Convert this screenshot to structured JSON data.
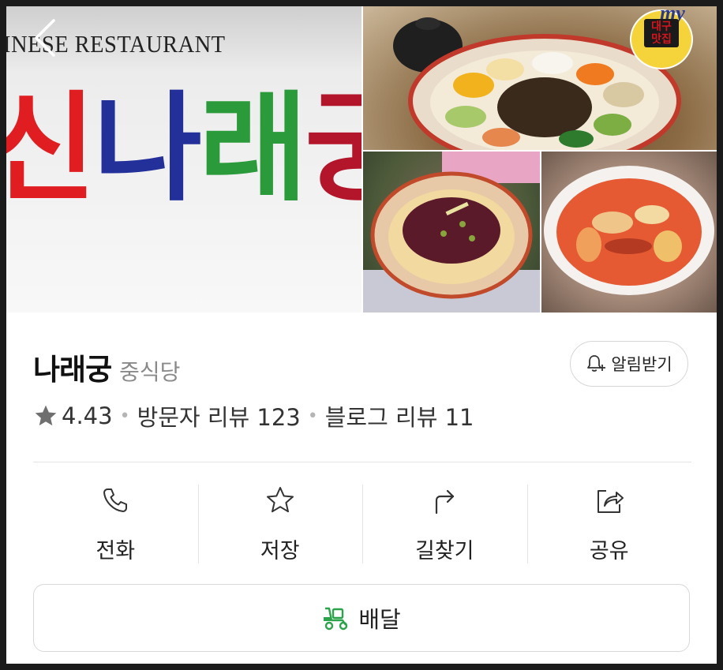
{
  "hero": {
    "sign_english": "INESE RESTAURANT",
    "sign_korean": [
      "신",
      "나",
      "래",
      "궁"
    ],
    "badge_text": "대구\n맛집",
    "badge_mark": "my"
  },
  "place": {
    "name": "나래궁",
    "category": "중식당",
    "rating": "4.43",
    "visitor_reviews": "방문자 리뷰 123",
    "blog_reviews": "블로그 리뷰 11",
    "alert_label": "알림받기"
  },
  "actions": [
    {
      "label": "전화",
      "icon": "phone-icon"
    },
    {
      "label": "저장",
      "icon": "star-outline-icon"
    },
    {
      "label": "길찾기",
      "icon": "directions-icon"
    },
    {
      "label": "공유",
      "icon": "share-icon"
    }
  ],
  "delivery": {
    "label": "배달",
    "icon": "delivery-scooter-icon"
  },
  "colors": {
    "accent_green": "#2aa34a",
    "text": "#222222",
    "muted": "#8a8a8a",
    "border": "#d8d8d8"
  }
}
